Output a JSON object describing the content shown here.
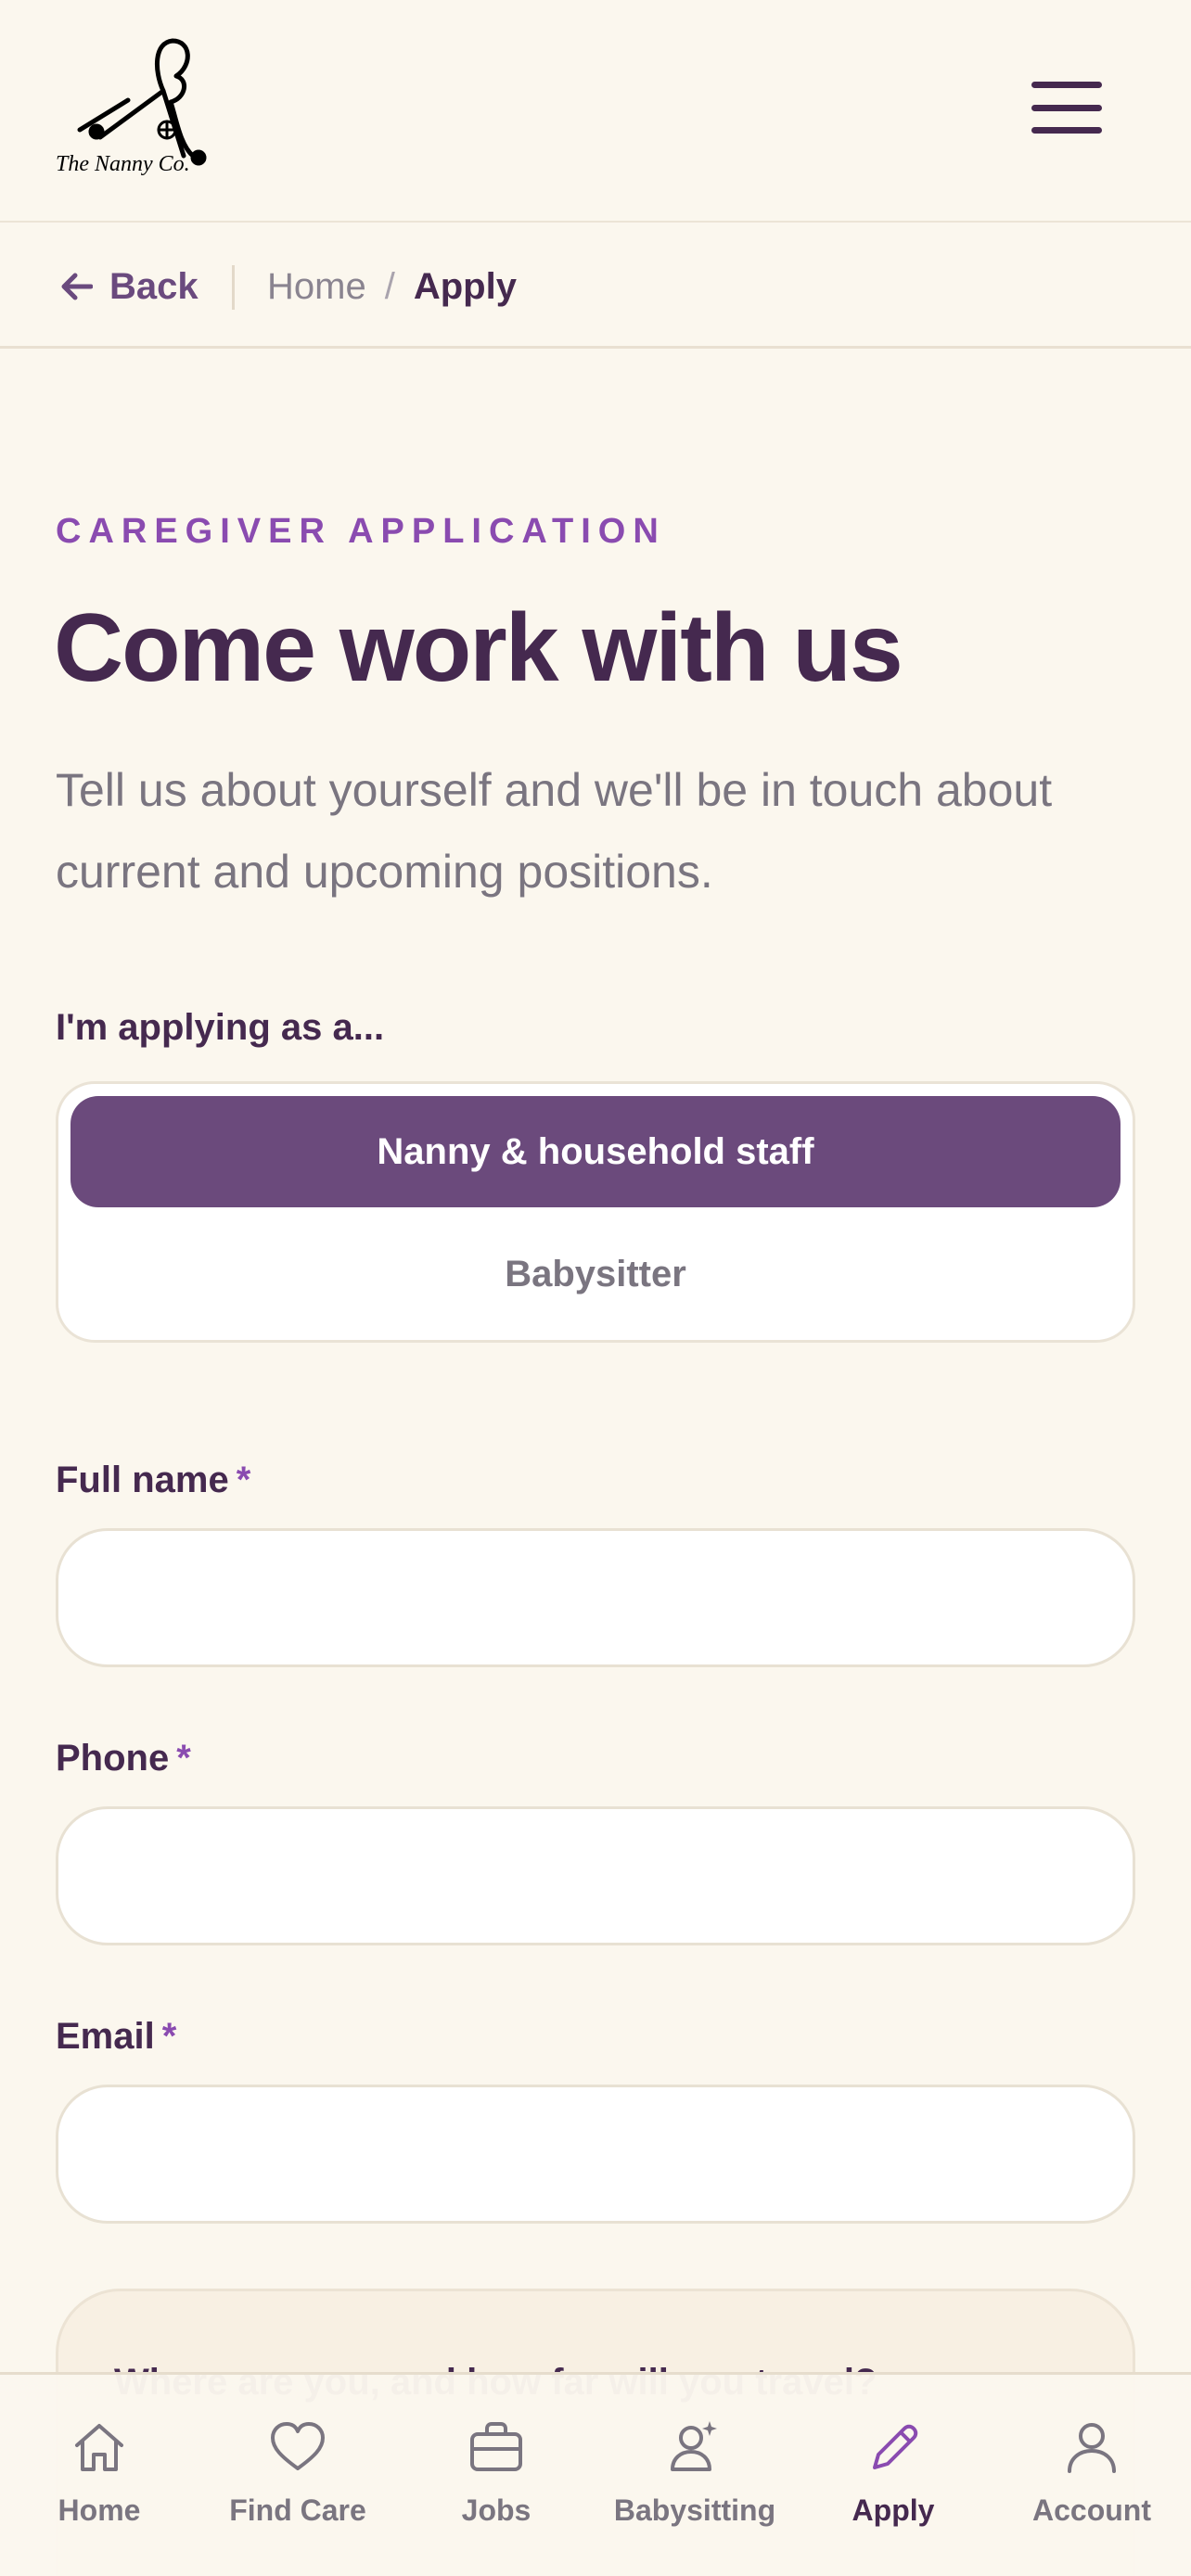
{
  "brand": {
    "logo_text": "The Nanny Co."
  },
  "breadcrumb": {
    "back_label": "Back",
    "home": "Home",
    "separator": "/",
    "current": "Apply"
  },
  "hero": {
    "eyebrow": "CAREGIVER APPLICATION",
    "title": "Come work with us",
    "subtitle": "Tell us about yourself and we'll be in touch about current and upcoming positions."
  },
  "role": {
    "label": "I'm applying as a...",
    "options": [
      "Nanny & household staff",
      "Babysitter"
    ],
    "selected": "Nanny & household staff"
  },
  "fields": [
    {
      "label": "Full name",
      "required_mark": "*",
      "value": ""
    },
    {
      "label": "Phone",
      "required_mark": "*",
      "value": ""
    },
    {
      "label": "Email",
      "required_mark": "*",
      "value": ""
    }
  ],
  "travel": {
    "question": "Where are you, and how far will you travel?"
  },
  "bottom_nav": [
    {
      "label": "Home",
      "icon": "home-icon"
    },
    {
      "label": "Find Care",
      "icon": "heart-icon"
    },
    {
      "label": "Jobs",
      "icon": "briefcase-icon"
    },
    {
      "label": "Babysitting",
      "icon": "babysitting-icon"
    },
    {
      "label": "Apply",
      "icon": "pencil-icon",
      "active": true
    },
    {
      "label": "Account",
      "icon": "user-icon"
    }
  ],
  "colors": {
    "primary": "#45294f",
    "accent": "#8a4bb0",
    "button": "#6b4a7c",
    "background": "#fbf7ee"
  }
}
